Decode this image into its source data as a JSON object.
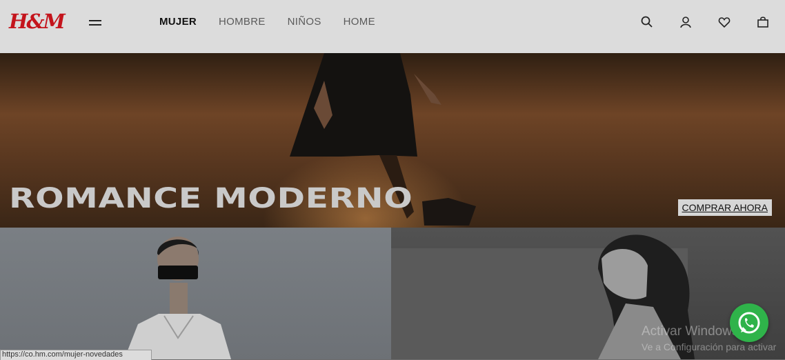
{
  "header": {
    "logo_text": "H&M",
    "nav": [
      {
        "label": "MUJER",
        "active": true
      },
      {
        "label": "HOMBRE",
        "active": false
      },
      {
        "label": "NIÑOS",
        "active": false
      },
      {
        "label": "HOME",
        "active": false
      }
    ],
    "icons": [
      "search-icon",
      "account-icon",
      "favorites-icon",
      "bag-icon"
    ]
  },
  "hero": {
    "title": "ROMANCE MODERNO",
    "cta_label": "COMPRAR AHORA"
  },
  "overlay": {
    "watermark_title": "Activar Windows",
    "watermark_sub": "Ve a Configuración para activar"
  },
  "status_bar": {
    "url": "https://co.hm.com/mujer-novedades"
  },
  "colors": {
    "brand_red": "#c4141c",
    "whatsapp_green": "#2fb34a"
  }
}
